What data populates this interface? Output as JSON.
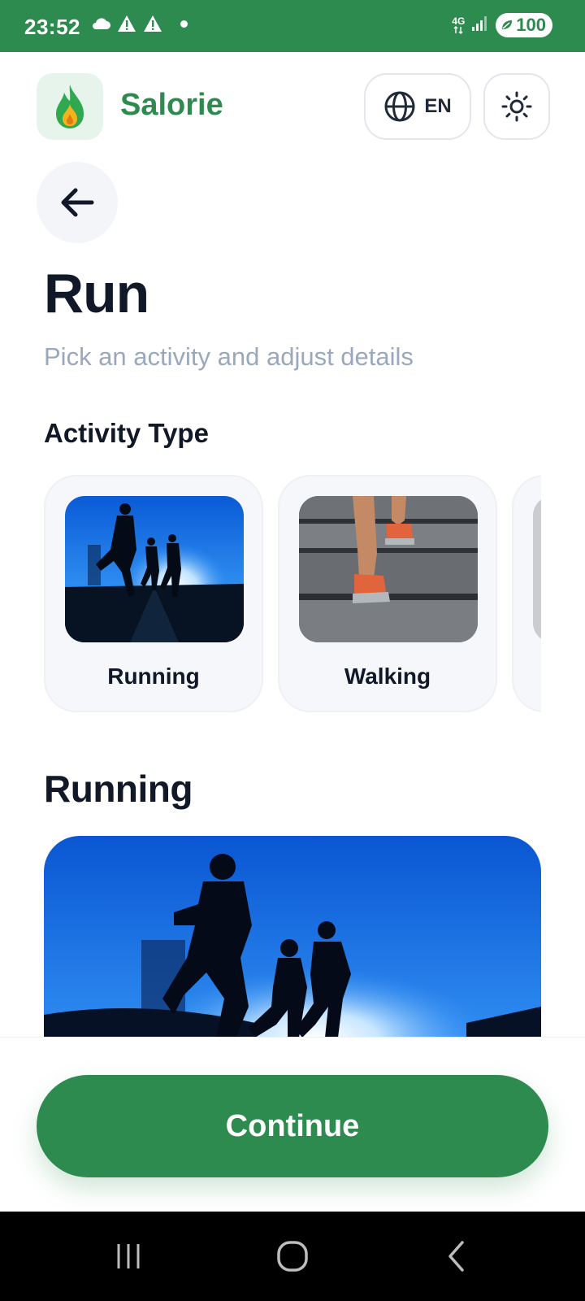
{
  "status_bar": {
    "time": "23:52",
    "network": "4G",
    "battery": "100",
    "icons": [
      "cloud-icon",
      "warning-icon",
      "warning-icon",
      "dot-icon",
      "signal-icon",
      "battery-icon"
    ]
  },
  "header": {
    "app_name": "Salorie",
    "language": "EN",
    "icons": {
      "logo": "flame-logo-icon",
      "language": "globe-icon",
      "theme": "sun-icon"
    }
  },
  "back_icon": "arrow-left-icon",
  "page": {
    "title": "Run",
    "subtitle": "Pick an activity and adjust details"
  },
  "activity_section": {
    "label": "Activity Type",
    "items": [
      {
        "label": "Running",
        "image": "runners-silhouette-photo"
      },
      {
        "label": "Walking",
        "image": "walking-stairs-photo"
      },
      {
        "label": "",
        "image": "partially-visible-card"
      }
    ]
  },
  "selected_activity": {
    "title": "Running",
    "image": "runners-silhouette-photo"
  },
  "continue_label": "Continue",
  "nav": {
    "icons": [
      "recent-apps-icon",
      "home-icon",
      "back-icon"
    ]
  },
  "colors": {
    "brand": "#2e8b4f",
    "subtitle": "#9aa8bd",
    "text": "#111827"
  }
}
